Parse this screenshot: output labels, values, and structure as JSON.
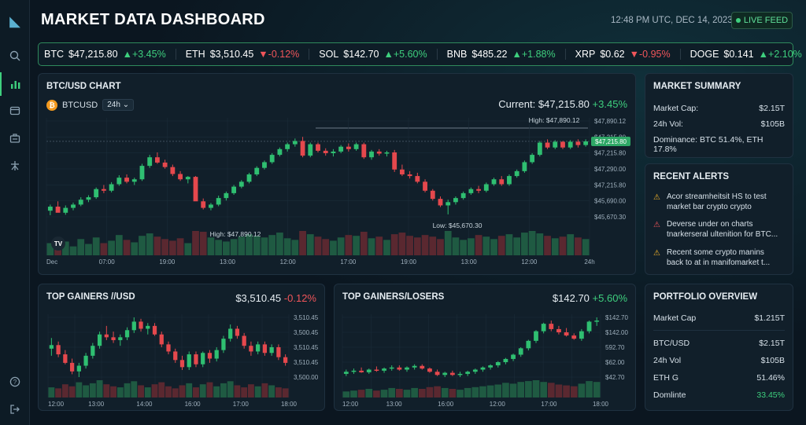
{
  "header": {
    "title": "MARKET DATA DASHBOARD",
    "timestamp": "12:48 PM UTC, DEC 14, 2023",
    "live_label": "LIVE FEED"
  },
  "ticker": [
    {
      "symbol": "BTC",
      "price": "$47,215.80",
      "change": "+3.45%",
      "dir": "up"
    },
    {
      "symbol": "ETH",
      "price": "$3,510.45",
      "change": "-0.12%",
      "dir": "dn"
    },
    {
      "symbol": "SOL",
      "price": "$142.70",
      "change": "+5.60%",
      "dir": "up"
    },
    {
      "symbol": "BNB",
      "price": "$485.22",
      "change": "+1.88%",
      "dir": "up"
    },
    {
      "symbol": "XRP",
      "price": "$0.62",
      "change": "-0.95%",
      "dir": "dn"
    },
    {
      "symbol": "DOGE",
      "price": "$0.141",
      "change": "+2.10%",
      "dir": "up"
    }
  ],
  "main_chart": {
    "title": "BTC/USD CHART",
    "pair": "BTCUSD",
    "timeframe": "24h",
    "current_label": "Current: $47,215.80",
    "current_change": "+3.45%",
    "high_label": "High: $47,890.12",
    "high_label_left": "High: $47,890.12",
    "low_label": "Low: $45,670.30",
    "price_tag": "$47,215.80",
    "logo": "TV"
  },
  "summary": {
    "title": "MARKET SUMMARY",
    "market_cap_label": "Market Cap:",
    "market_cap_value": "$2.15T",
    "vol_label": "24h Vol:",
    "vol_value": "$105B",
    "dominance": "Dominance: BTC 51.4%, ETH 17.8%"
  },
  "alerts": {
    "title": "RECENT ALERTS",
    "items": [
      {
        "line1": "Acor streamheitsit HS to test",
        "line2": "market bar crypto crypto",
        "color": "#f3b32a"
      },
      {
        "line1": "Deverse under on charts",
        "line2": "tnarkerseral ultenition for BTC...",
        "color": "#f0555a"
      },
      {
        "line1": "Recent some crypto manins",
        "line2": "back to at in manifomarket t...",
        "color": "#f3b32a"
      }
    ]
  },
  "gainers_left": {
    "title": "TOP GAINERS //USD",
    "price": "$3,510.45",
    "change": "-0.12%"
  },
  "gainers_right": {
    "title": "TOP GAINERS/LOSERS",
    "price": "$142.70",
    "change": "+5.60%"
  },
  "portfolio": {
    "title": "PORTFOLIO OVERVIEW",
    "rows": [
      {
        "label": "Market Cap",
        "value": "$1.215T",
        "color": "#d6e0e8"
      },
      {
        "label": "BTC/USD",
        "value": "$2.15T",
        "color": "#d6e0e8"
      },
      {
        "label": "24h Vol",
        "value": "$105B",
        "color": "#d6e0e8"
      },
      {
        "label": "ETH G",
        "value": "51.46%",
        "color": "#d6e0e8"
      },
      {
        "label": "Domlinte",
        "value": "33.45%",
        "color": "#3ecf7e"
      }
    ]
  },
  "chart_data": [
    {
      "type": "candlestick",
      "title": "BTC/USD CHART",
      "x_ticks": [
        "Dec",
        "07:00",
        "19:00",
        "13:00",
        "12:00",
        "17:00",
        "19:00",
        "13:00",
        "12:00",
        "24h"
      ],
      "y_ticks": [
        "$47,890.12",
        "$47,215.80",
        "$47,215.80",
        "$47,290.00",
        "$47,215.80",
        "$45,690.00",
        "$45,670.30"
      ],
      "ohlc": [
        [
          45750,
          45900,
          45640,
          45850
        ],
        [
          45850,
          45980,
          45780,
          45700
        ],
        [
          45700,
          45880,
          45650,
          45820
        ],
        [
          45820,
          45950,
          45760,
          45900
        ],
        [
          45900,
          46080,
          45860,
          46020
        ],
        [
          46020,
          46130,
          45960,
          46080
        ],
        [
          46080,
          46320,
          46040,
          46280
        ],
        [
          46280,
          46380,
          46180,
          46240
        ],
        [
          46240,
          46450,
          46200,
          46400
        ],
        [
          46400,
          46620,
          46360,
          46560
        ],
        [
          46560,
          46640,
          46420,
          46460
        ],
        [
          46460,
          46560,
          46380,
          46520
        ],
        [
          46520,
          46900,
          46480,
          46850
        ],
        [
          46850,
          47120,
          46800,
          47060
        ],
        [
          47060,
          47180,
          46900,
          46930
        ],
        [
          46930,
          47000,
          46780,
          46820
        ],
        [
          46820,
          46880,
          46600,
          46650
        ],
        [
          46650,
          46720,
          46480,
          46520
        ],
        [
          46520,
          46600,
          46420,
          46580
        ],
        [
          46580,
          46600,
          46100,
          45980
        ],
        [
          45980,
          46050,
          45780,
          45820
        ],
        [
          45820,
          45940,
          45760,
          45900
        ],
        [
          45900,
          46120,
          45860,
          46060
        ],
        [
          46060,
          46220,
          46000,
          46180
        ],
        [
          46180,
          46380,
          46140,
          46340
        ],
        [
          46340,
          46500,
          46300,
          46460
        ],
        [
          46460,
          46680,
          46420,
          46640
        ],
        [
          46640,
          46840,
          46600,
          46800
        ],
        [
          46800,
          46980,
          46760,
          46940
        ],
        [
          46940,
          47160,
          46900,
          47120
        ],
        [
          47120,
          47300,
          47080,
          47260
        ],
        [
          47260,
          47420,
          47200,
          47380
        ],
        [
          47380,
          47520,
          47320,
          47460
        ],
        [
          47460,
          47560,
          47060,
          47100
        ],
        [
          47100,
          47420,
          47060,
          47380
        ],
        [
          47380,
          47420,
          47180,
          47220
        ],
        [
          47220,
          47280,
          47100,
          47160
        ],
        [
          47160,
          47260,
          47080,
          47200
        ],
        [
          47200,
          47360,
          47160,
          47320
        ],
        [
          47320,
          47400,
          47200,
          47260
        ],
        [
          47260,
          47420,
          47220,
          47380
        ],
        [
          47380,
          47420,
          47020,
          47060
        ],
        [
          47060,
          47240,
          47000,
          47200
        ],
        [
          47200,
          47260,
          47100,
          47150
        ],
        [
          47150,
          47220,
          47080,
          47180
        ],
        [
          47180,
          47240,
          46700,
          46760
        ],
        [
          46760,
          46880,
          46600,
          46640
        ],
        [
          46640,
          46720,
          46540,
          46600
        ],
        [
          46600,
          46680,
          46420,
          46460
        ],
        [
          46460,
          46520,
          46200,
          46240
        ],
        [
          46240,
          46280,
          46000,
          46040
        ],
        [
          46040,
          46100,
          45840,
          45880
        ],
        [
          45880,
          46020,
          45660,
          45960
        ],
        [
          45960,
          46100,
          45900,
          46060
        ],
        [
          46060,
          46220,
          46020,
          46180
        ],
        [
          46180,
          46320,
          46140,
          46280
        ],
        [
          46280,
          46360,
          46180,
          46240
        ],
        [
          46240,
          46440,
          46200,
          46400
        ],
        [
          46400,
          46560,
          46360,
          46520
        ],
        [
          46520,
          46600,
          46360,
          46400
        ],
        [
          46400,
          46640,
          46360,
          46600
        ],
        [
          46600,
          46760,
          46560,
          46720
        ],
        [
          46720,
          46980,
          46680,
          46940
        ],
        [
          46940,
          47160,
          46900,
          47120
        ],
        [
          47120,
          47460,
          47080,
          47420
        ],
        [
          47420,
          47500,
          47260,
          47300
        ],
        [
          47300,
          47480,
          47260,
          47440
        ],
        [
          47440,
          47460,
          47260,
          47300
        ],
        [
          47300,
          47480,
          47260,
          47440
        ],
        [
          47440,
          47500,
          47300,
          47360
        ],
        [
          47360,
          47500,
          47320,
          47450
        ]
      ],
      "volume": [
        30,
        26,
        34,
        22,
        40,
        28,
        44,
        30,
        36,
        50,
        38,
        32,
        48,
        54,
        46,
        40,
        36,
        42,
        30,
        60,
        58,
        44,
        38,
        34,
        40,
        46,
        52,
        48,
        44,
        50,
        56,
        42,
        38,
        60,
        52,
        46,
        40,
        36,
        44,
        50,
        48,
        58,
        42,
        46,
        38,
        52,
        56,
        48,
        44,
        50,
        46,
        40,
        60,
        44,
        38,
        42,
        50,
        46,
        40,
        48,
        52,
        44,
        56,
        60,
        54,
        48,
        42,
        46,
        52,
        44,
        40
      ],
      "ylim": [
        45600,
        47950
      ]
    },
    {
      "type": "candlestick",
      "title": "TOP GAINERS //USD",
      "x_ticks": [
        "12:00",
        "13:00",
        "14:00",
        "16:00",
        "17:00",
        "18:00"
      ],
      "y_ticks": [
        "3,510.45",
        "3,500.45",
        "3,510.45",
        "3,510.45",
        "3,500.00"
      ],
      "ohlc": [
        [
          3506,
          3507.5,
          3505,
          3506.5
        ],
        [
          3506.5,
          3507,
          3504.8,
          3505.2
        ],
        [
          3505.2,
          3505.8,
          3503.8,
          3504
        ],
        [
          3504,
          3504.6,
          3502.4,
          3502.8
        ],
        [
          3502.8,
          3504,
          3502,
          3503.6
        ],
        [
          3503.6,
          3505.4,
          3503.2,
          3505
        ],
        [
          3505,
          3506.8,
          3504.6,
          3506.4
        ],
        [
          3506.4,
          3508.4,
          3506,
          3508
        ],
        [
          3508,
          3509.2,
          3507.2,
          3507.6
        ],
        [
          3507.6,
          3508.4,
          3506.8,
          3507.2
        ],
        [
          3507.2,
          3508,
          3506.4,
          3507.6
        ],
        [
          3507.6,
          3509,
          3507.2,
          3508.6
        ],
        [
          3508.6,
          3510.4,
          3508.2,
          3509.8
        ],
        [
          3509.8,
          3510.2,
          3508.4,
          3508.8
        ],
        [
          3508.8,
          3509.6,
          3508,
          3509.2
        ],
        [
          3509.2,
          3509.6,
          3507.8,
          3508
        ],
        [
          3508,
          3508.4,
          3506.2,
          3506.6
        ],
        [
          3506.6,
          3507,
          3505.2,
          3505.6
        ],
        [
          3505.6,
          3506,
          3504,
          3504.4
        ],
        [
          3504.4,
          3505,
          3503,
          3503.4
        ],
        [
          3503.4,
          3505.6,
          3503,
          3505.2
        ],
        [
          3505.2,
          3505.6,
          3503.4,
          3503.8
        ],
        [
          3503.8,
          3505.6,
          3503.4,
          3505.4
        ],
        [
          3505.4,
          3505.8,
          3504,
          3504.6
        ],
        [
          3504.6,
          3506.2,
          3504.2,
          3505.8
        ],
        [
          3505.8,
          3507.8,
          3505.4,
          3507.4
        ],
        [
          3507.4,
          3509.4,
          3507,
          3508.8
        ],
        [
          3508.8,
          3509.2,
          3507.4,
          3507.8
        ],
        [
          3507.8,
          3508.2,
          3506,
          3506.4
        ],
        [
          3506.4,
          3507,
          3505,
          3505.6
        ],
        [
          3505.6,
          3507,
          3505.2,
          3506.6
        ],
        [
          3506.6,
          3507,
          3505,
          3505.4
        ],
        [
          3505.4,
          3506.6,
          3505,
          3506.2
        ],
        [
          3506.2,
          3506.6,
          3504.4,
          3504.8
        ],
        [
          3504.8,
          3505.2,
          3503.6,
          3504
        ]
      ],
      "volume": [
        20,
        18,
        26,
        22,
        30,
        24,
        28,
        34,
        26,
        22,
        20,
        28,
        32,
        24,
        20,
        26,
        30,
        22,
        18,
        24,
        28,
        20,
        26,
        30,
        22,
        28,
        32,
        24,
        20,
        26,
        22,
        28,
        24,
        20,
        18
      ]
    },
    {
      "type": "candlestick",
      "title": "TOP GAINERS/LOSERS",
      "x_ticks": [
        "12:00",
        "13:00",
        "16:00",
        "12:00",
        "17:00",
        "18:00"
      ],
      "y_ticks": [
        "$142.70",
        "$142.00",
        "592.70",
        "$62.00",
        "$42.70"
      ],
      "ohlc": [
        [
          40,
          48,
          36,
          44
        ],
        [
          44,
          50,
          40,
          46
        ],
        [
          46,
          52,
          42,
          43
        ],
        [
          43,
          50,
          40,
          48
        ],
        [
          48,
          54,
          44,
          46
        ],
        [
          46,
          52,
          42,
          50
        ],
        [
          50,
          56,
          46,
          52
        ],
        [
          52,
          56,
          46,
          48
        ],
        [
          48,
          54,
          44,
          52
        ],
        [
          52,
          58,
          48,
          55
        ],
        [
          55,
          58,
          48,
          50
        ],
        [
          50,
          52,
          42,
          44
        ],
        [
          44,
          48,
          36,
          38
        ],
        [
          38,
          44,
          34,
          42
        ],
        [
          42,
          46,
          36,
          38
        ],
        [
          38,
          44,
          34,
          40
        ],
        [
          40,
          46,
          36,
          44
        ],
        [
          44,
          50,
          40,
          48
        ],
        [
          48,
          54,
          44,
          52
        ],
        [
          52,
          58,
          48,
          56
        ],
        [
          56,
          64,
          52,
          62
        ],
        [
          62,
          70,
          58,
          68
        ],
        [
          68,
          78,
          64,
          76
        ],
        [
          76,
          90,
          72,
          88
        ],
        [
          88,
          104,
          84,
          102
        ],
        [
          102,
          122,
          98,
          120
        ],
        [
          120,
          136,
          116,
          134
        ],
        [
          134,
          140,
          120,
          124
        ],
        [
          124,
          130,
          114,
          118
        ],
        [
          118,
          126,
          110,
          112
        ],
        [
          112,
          116,
          104,
          106
        ],
        [
          106,
          124,
          102,
          120
        ],
        [
          120,
          140,
          116,
          138
        ],
        [
          138,
          146,
          130,
          140
        ]
      ],
      "volume": [
        14,
        16,
        18,
        20,
        16,
        18,
        22,
        20,
        18,
        22,
        20,
        24,
        26,
        22,
        20,
        18,
        22,
        24,
        26,
        28,
        30,
        34,
        32,
        36,
        38,
        40,
        36,
        34,
        30,
        28,
        26,
        32,
        38,
        36
      ]
    }
  ]
}
